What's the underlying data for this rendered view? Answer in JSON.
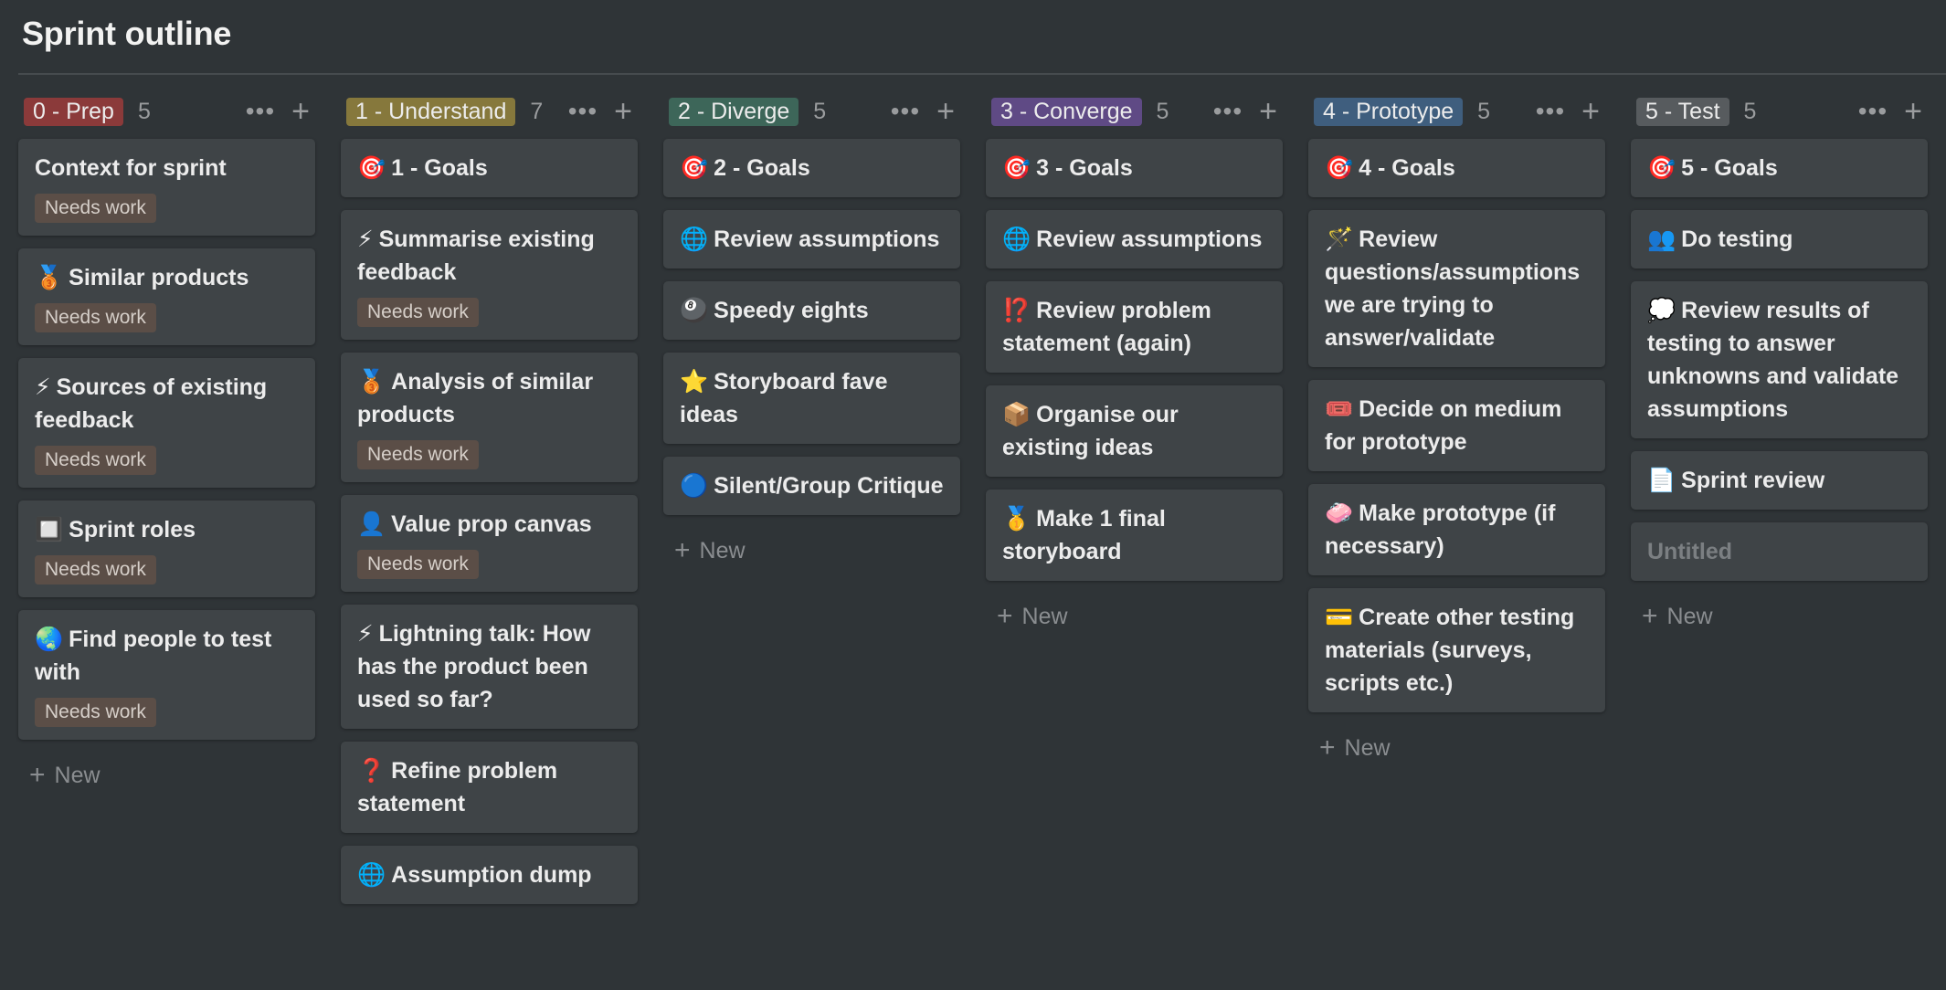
{
  "page": {
    "title": "Sprint outline"
  },
  "columns": [
    {
      "label": "0 - Prep",
      "count": "5",
      "color": "#8b3a3a",
      "cards": [
        {
          "icon": "",
          "title": "Context for sprint",
          "badge": "Needs work"
        },
        {
          "icon": "🥉",
          "title": "Similar products",
          "badge": "Needs work"
        },
        {
          "icon": "⚡",
          "title": "Sources of existing feedback",
          "badge": "Needs work"
        },
        {
          "icon": "🔲",
          "title": "Sprint roles",
          "badge": "Needs work"
        },
        {
          "icon": "🌏",
          "title": "Find people to test with",
          "badge": "Needs work"
        }
      ],
      "new_label": "New"
    },
    {
      "label": "1 - Understand",
      "count": "7",
      "color": "#86783c",
      "cards": [
        {
          "icon": "🎯",
          "title": "1 - Goals",
          "badge": ""
        },
        {
          "icon": "⚡",
          "title": "Summarise existing feedback",
          "badge": "Needs work"
        },
        {
          "icon": "🥉",
          "title": "Analysis of similar products",
          "badge": "Needs work"
        },
        {
          "icon": "👤",
          "title": "Value prop canvas",
          "badge": "Needs work"
        },
        {
          "icon": "⚡",
          "title": "Lightning talk: How has the product been used so far?",
          "badge": ""
        },
        {
          "icon": "❓",
          "title": "Refine problem statement",
          "badge": ""
        },
        {
          "icon": "🌐",
          "title": "Assumption dump",
          "badge": ""
        }
      ],
      "new_label": ""
    },
    {
      "label": "2 - Diverge",
      "count": "5",
      "color": "#3d6659",
      "cards": [
        {
          "icon": "🎯",
          "title": "2 - Goals",
          "badge": ""
        },
        {
          "icon": "🌐",
          "title": "Review assumptions",
          "badge": ""
        },
        {
          "icon": "🎱",
          "title": "Speedy eights",
          "badge": ""
        },
        {
          "icon": "⭐",
          "title": "Storyboard fave ideas",
          "badge": ""
        },
        {
          "icon": "🔵",
          "title": "Silent/Group Critique",
          "badge": ""
        }
      ],
      "new_label": "New"
    },
    {
      "label": "3 - Converge",
      "count": "5",
      "color": "#5f4a85",
      "cards": [
        {
          "icon": "🎯",
          "title": "3 - Goals",
          "badge": ""
        },
        {
          "icon": "🌐",
          "title": "Review assumptions",
          "badge": ""
        },
        {
          "icon": "⁉️",
          "title": "Review problem statement (again)",
          "badge": ""
        },
        {
          "icon": "📦",
          "title": "Organise our existing ideas",
          "badge": ""
        },
        {
          "icon": "🥇",
          "title": "Make 1 final storyboard",
          "badge": ""
        }
      ],
      "new_label": "New"
    },
    {
      "label": "4 - Prototype",
      "count": "5",
      "color": "#3f5e7e",
      "cards": [
        {
          "icon": "🎯",
          "title": "4 - Goals",
          "badge": ""
        },
        {
          "icon": "🪄",
          "title": "Review questions/assumptions we are trying to answer/validate",
          "badge": ""
        },
        {
          "icon": "🎟️",
          "title": "Decide on medium for prototype",
          "badge": ""
        },
        {
          "icon": "🧼",
          "title": "Make prototype (if necessary)",
          "badge": ""
        },
        {
          "icon": "💳",
          "title": "Create other testing materials (surveys, scripts etc.)",
          "badge": ""
        }
      ],
      "new_label": "New"
    },
    {
      "label": "5 - Test",
      "count": "5",
      "color": "#575b5e",
      "cards": [
        {
          "icon": "🎯",
          "title": "5 - Goals",
          "badge": ""
        },
        {
          "icon": "👥",
          "title": "Do testing",
          "badge": ""
        },
        {
          "icon": "💭",
          "title": "Review results of testing to answer unknowns and validate assumptions",
          "badge": ""
        },
        {
          "icon": "📄",
          "title": "Sprint review",
          "badge": ""
        },
        {
          "icon": "",
          "title": "Untitled",
          "badge": "",
          "placeholder": true
        }
      ],
      "new_label": "New"
    }
  ]
}
